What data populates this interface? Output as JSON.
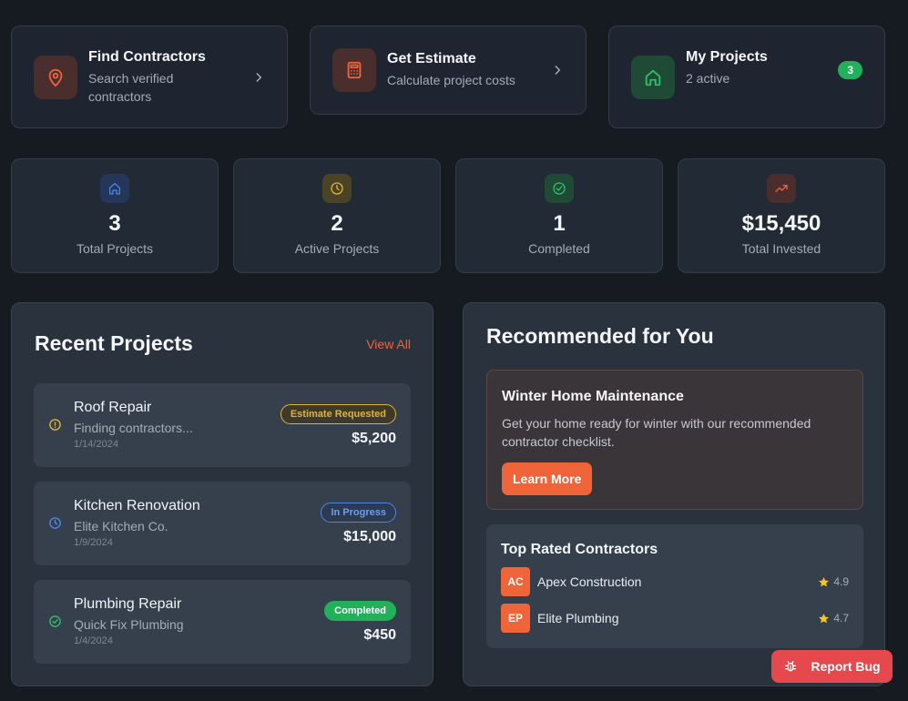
{
  "quick_actions": [
    {
      "title": "Find Contractors",
      "subtitle": "Search verified contractors"
    },
    {
      "title": "Get Estimate",
      "subtitle": "Calculate project costs"
    },
    {
      "title": "My Projects",
      "subtitle": "2 active",
      "badge": "3"
    }
  ],
  "stats": [
    {
      "value": "3",
      "label": "Total Projects",
      "icon": "home-icon"
    },
    {
      "value": "2",
      "label": "Active Projects",
      "icon": "clock-icon"
    },
    {
      "value": "1",
      "label": "Completed",
      "icon": "check-circle-icon"
    },
    {
      "value": "$15,450",
      "label": "Total Invested",
      "icon": "trending-up-icon"
    }
  ],
  "recent_projects": {
    "title": "Recent Projects",
    "view_all": "View All",
    "items": [
      {
        "name": "Roof Repair",
        "contractor": "Finding contractors...",
        "date": "1/14/2024",
        "status": "Estimate Requested",
        "amount": "$5,200"
      },
      {
        "name": "Kitchen Renovation",
        "contractor": "Elite Kitchen Co.",
        "date": "1/9/2024",
        "status": "In Progress",
        "amount": "$15,000"
      },
      {
        "name": "Plumbing Repair",
        "contractor": "Quick Fix Plumbing",
        "date": "1/4/2024",
        "status": "Completed",
        "amount": "$450"
      }
    ]
  },
  "recommended": {
    "title": "Recommended for You",
    "promo": {
      "title": "Winter Home Maintenance",
      "body": "Get your home ready for winter with our recommended contractor checklist.",
      "button": "Learn More"
    },
    "top_rated": {
      "title": "Top Rated Contractors",
      "items": [
        {
          "initials": "AC",
          "name": "Apex Construction",
          "rating": "4.9"
        },
        {
          "initials": "EP",
          "name": "Elite Plumbing",
          "rating": "4.7"
        }
      ]
    }
  },
  "report_bug": "Report Bug",
  "colors": {
    "accent": "#f0643a",
    "warning": "#e0b23a",
    "info": "#4a86e8",
    "success": "#22b05a",
    "danger": "#e5484d"
  }
}
